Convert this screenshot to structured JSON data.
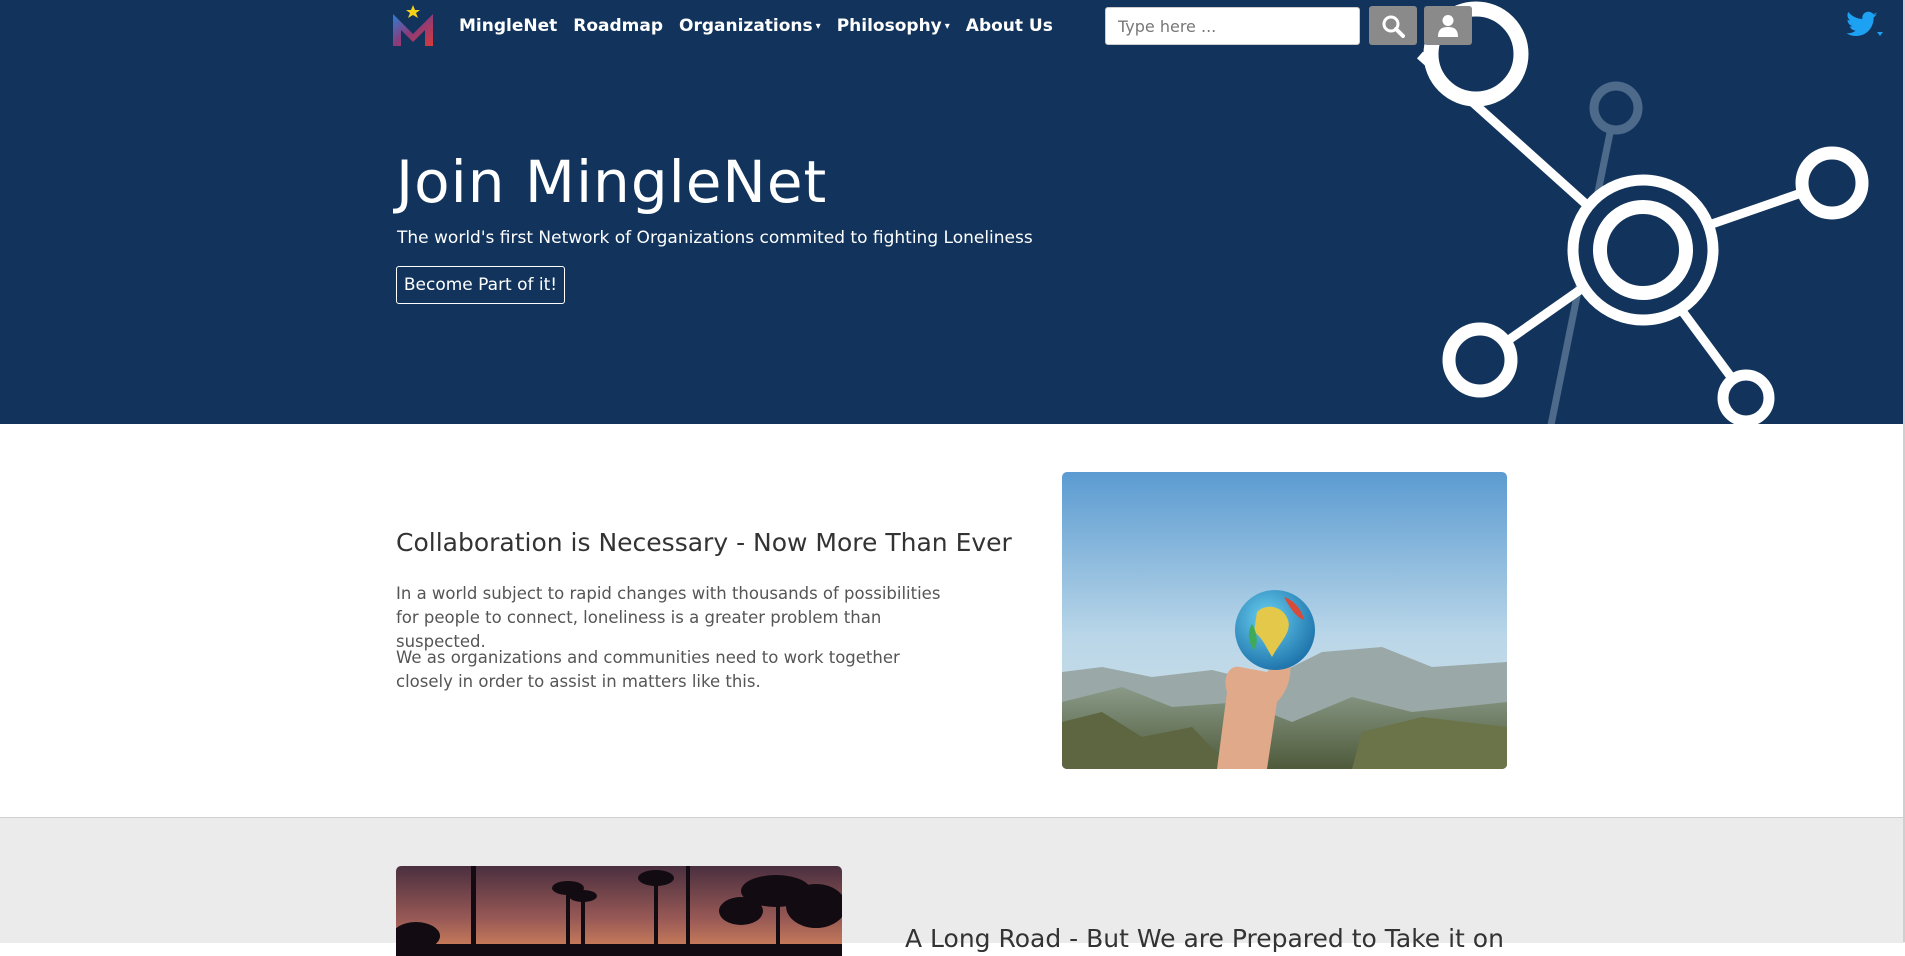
{
  "nav": {
    "brand": "MingleNet",
    "items": [
      {
        "label": "Roadmap",
        "has_dropdown": false
      },
      {
        "label": "Organizations",
        "has_dropdown": true
      },
      {
        "label": "Philosophy",
        "has_dropdown": true
      },
      {
        "label": "About Us",
        "has_dropdown": false
      }
    ],
    "dropdown_caret": "▾",
    "search_placeholder": "Type here ...",
    "search_icon": "search-icon",
    "user_icon": "user-icon",
    "social_icon": "twitter-icon"
  },
  "hero": {
    "title": "Join MingleNet",
    "subtitle": "The world's first Network of Organizations commited to fighting Loneliness",
    "cta_label": "Become Part of it!",
    "background_color": "#12345c"
  },
  "collaboration": {
    "heading": "Collaboration is Necessary - Now More Than Ever",
    "paragraphs": [
      "In a world subject to rapid changes with thousands of possibilities for people to connect, loneliness is a greater problem than suspected.",
      "We as organizations and communities need to work together closely in order to assist in matters like this."
    ]
  },
  "long_road": {
    "heading": "A Long Road - But We are Prepared to Take it on"
  },
  "colors": {
    "accent_blue": "#12345c",
    "twitter_blue": "#1da1f2",
    "button_gray": "#8a8a8a"
  }
}
